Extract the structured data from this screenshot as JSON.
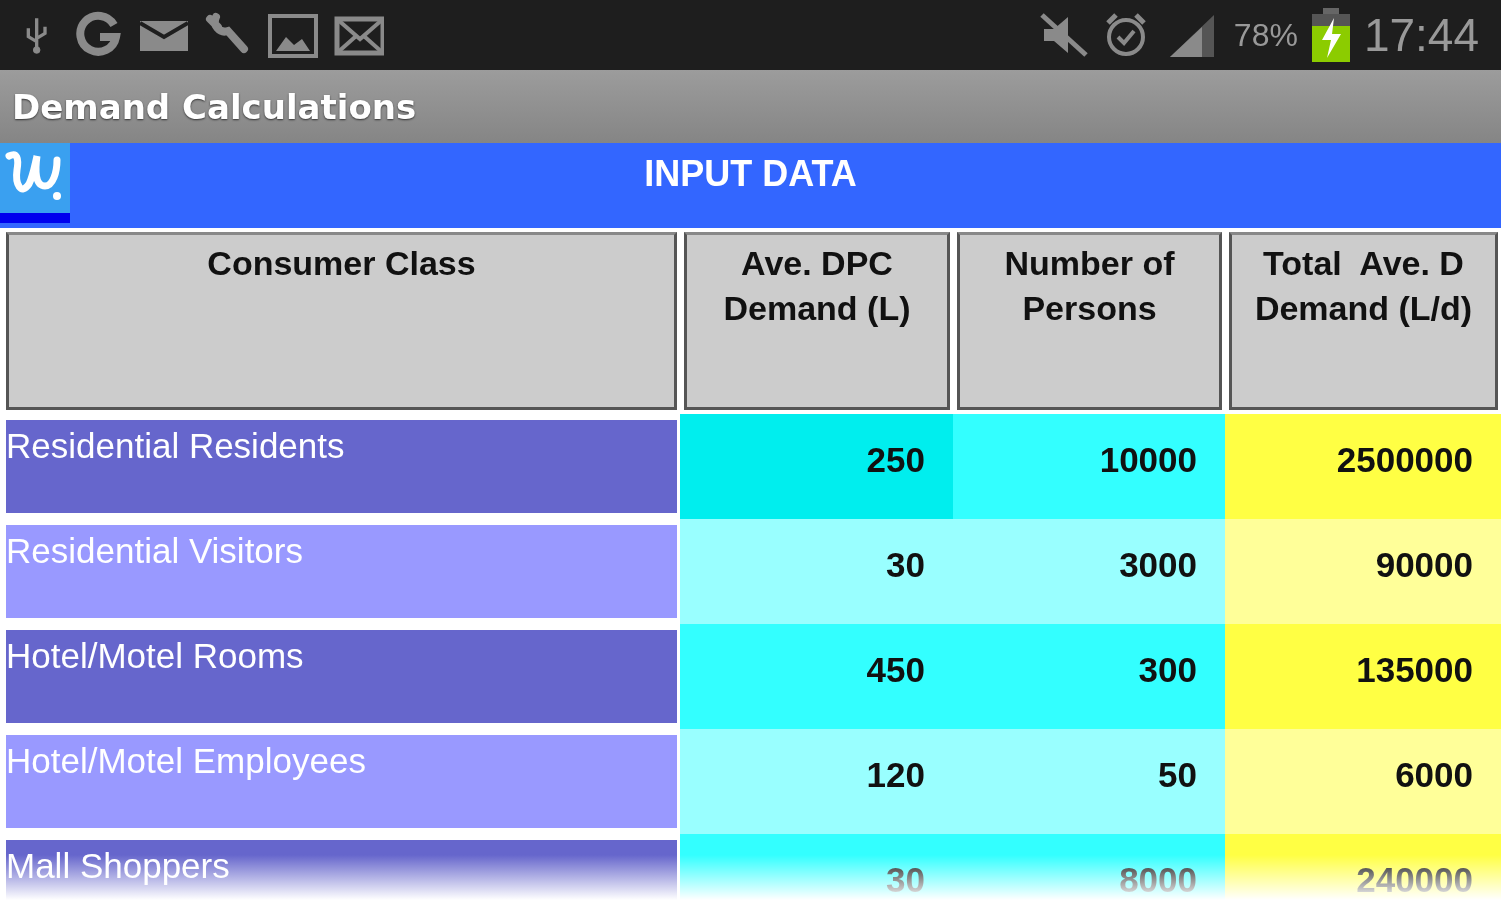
{
  "status_bar": {
    "battery": "78%",
    "time": "17:44"
  },
  "title_bar": {
    "title": "Demand Calculations"
  },
  "banner": {
    "title": "INPUT DATA"
  },
  "table": {
    "columns": [
      "Consumer Class",
      "Ave. DPC Demand (L)",
      "Number of Persons",
      "Total  Ave. D Demand (L/d)"
    ],
    "rows": [
      {
        "color": "#6666cc",
        "cells": [
          "Residential Residents",
          "250",
          "10000",
          "2500000"
        ]
      },
      {
        "color": "#9999ff",
        "cells": [
          "Residential Visitors",
          "30",
          "3000",
          "90000"
        ]
      },
      {
        "color": "#6666cc",
        "cells": [
          "Hotel/Motel Rooms",
          "450",
          "300",
          "135000"
        ]
      },
      {
        "color": "#9999ff",
        "cells": [
          "Hotel/Motel Employees",
          "120",
          "50",
          "6000"
        ]
      },
      {
        "color": "#6666cc",
        "cells": [
          "Mall Shoppers",
          "30",
          "8000",
          "240000"
        ]
      }
    ]
  }
}
